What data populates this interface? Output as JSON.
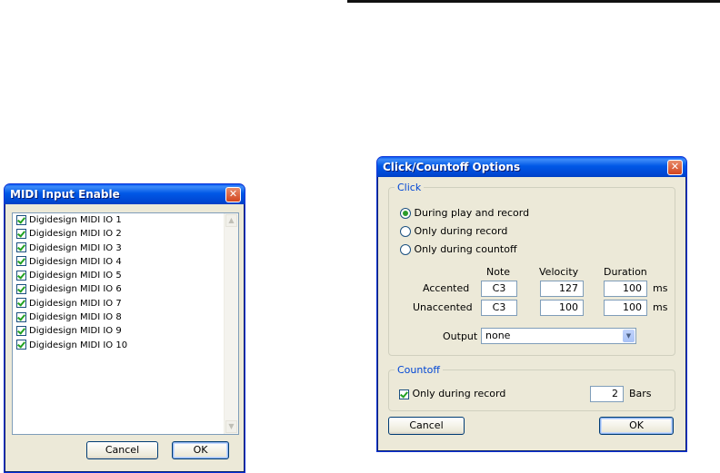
{
  "midi_dialog": {
    "title": "MIDI Input Enable",
    "items": [
      {
        "label": "Digidesign MIDI IO 1",
        "checked": true
      },
      {
        "label": "Digidesign MIDI IO 2",
        "checked": true
      },
      {
        "label": "Digidesign MIDI IO 3",
        "checked": true
      },
      {
        "label": "Digidesign MIDI IO 4",
        "checked": true
      },
      {
        "label": "Digidesign MIDI IO 5",
        "checked": true
      },
      {
        "label": "Digidesign MIDI IO 6",
        "checked": true
      },
      {
        "label": "Digidesign MIDI IO 7",
        "checked": true
      },
      {
        "label": "Digidesign MIDI IO 8",
        "checked": true
      },
      {
        "label": "Digidesign MIDI IO 9",
        "checked": true
      },
      {
        "label": "Digidesign MIDI IO 10",
        "checked": true
      }
    ],
    "cancel_label": "Cancel",
    "ok_label": "OK"
  },
  "click_dialog": {
    "title": "Click/Countoff Options",
    "click_group": {
      "legend": "Click",
      "options": [
        {
          "label": "During play and record",
          "selected": true
        },
        {
          "label": "Only during record",
          "selected": false
        },
        {
          "label": "Only during countoff",
          "selected": false
        }
      ],
      "columns": {
        "note": "Note",
        "velocity": "Velocity",
        "duration": "Duration"
      },
      "accented": {
        "label": "Accented",
        "note": "C3",
        "velocity": "127",
        "duration": "100",
        "unit": "ms"
      },
      "unaccented": {
        "label": "Unaccented",
        "note": "C3",
        "velocity": "100",
        "duration": "100",
        "unit": "ms"
      },
      "output_label": "Output",
      "output_value": "none"
    },
    "countoff_group": {
      "legend": "Countoff",
      "only_during_record_label": "Only during record",
      "only_during_record_checked": true,
      "bars_value": "2",
      "bars_label": "Bars"
    },
    "cancel_label": "Cancel",
    "ok_label": "OK"
  },
  "colors": {
    "titlebar": "#0058e6",
    "dialog_bg": "#ece9d8",
    "group_legend": "#0046d5",
    "close_button": "#d2451e"
  }
}
